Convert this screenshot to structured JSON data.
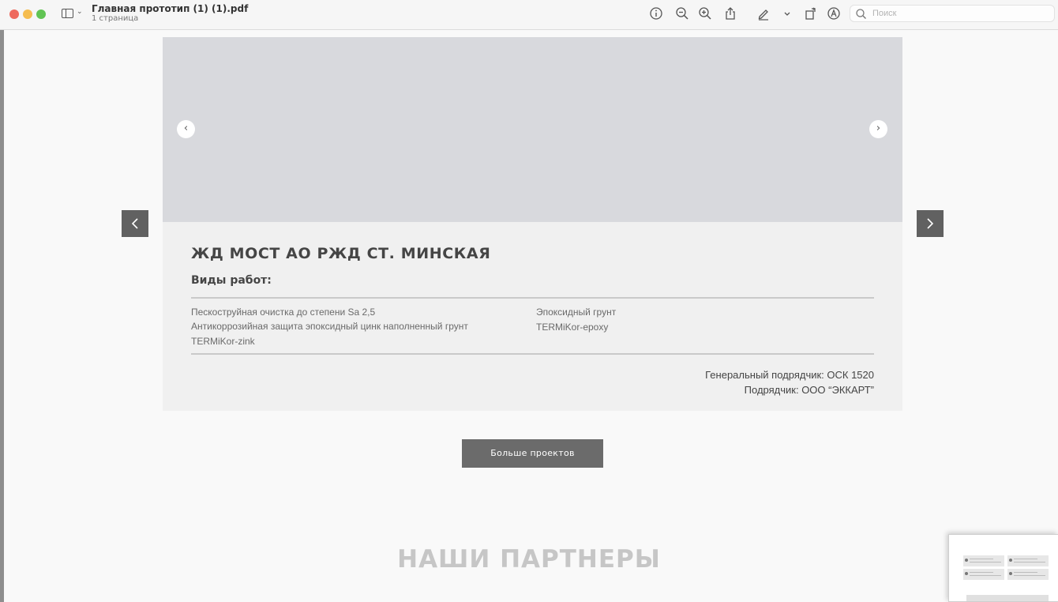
{
  "window": {
    "title": "Главная прототип (1) (1).pdf",
    "subtitle": "1 страница"
  },
  "toolbar": {
    "icons": [
      "info-icon",
      "zoom-out-icon",
      "zoom-in-icon",
      "share-icon",
      "markup-pen-icon",
      "chevron-down-icon",
      "rotate-icon",
      "annotate-icon"
    ],
    "search_placeholder": "Поиск"
  },
  "project": {
    "title": "ЖД МОСТ АО РЖД СТ. МИНСКАЯ",
    "works_label": "Виды работ:",
    "works_left": [
      "Пескоструйная очистка до степени Sa 2,5",
      "Антикоррозийная защита эпоксидный цинк наполненный грунт",
      "TERMiKor-zink"
    ],
    "works_right": [
      "Эпоксидный грунт",
      "TERMiKor-epoxy"
    ],
    "general_contractor": "Генеральный подрядчик: ОСК 1520",
    "contractor": "Подрядчик: ООО “ЭККАРТ”"
  },
  "more_button": "Больше проектов",
  "partners_title": "НАШИ ПАРТНЕРЫ",
  "colors": {
    "image_placeholder": "#d8d9dd",
    "card_bg": "#f0f0f0",
    "arrow_bg": "#616161",
    "button_bg": "#6b6b6b",
    "partners_text": "#c6c6c6"
  }
}
